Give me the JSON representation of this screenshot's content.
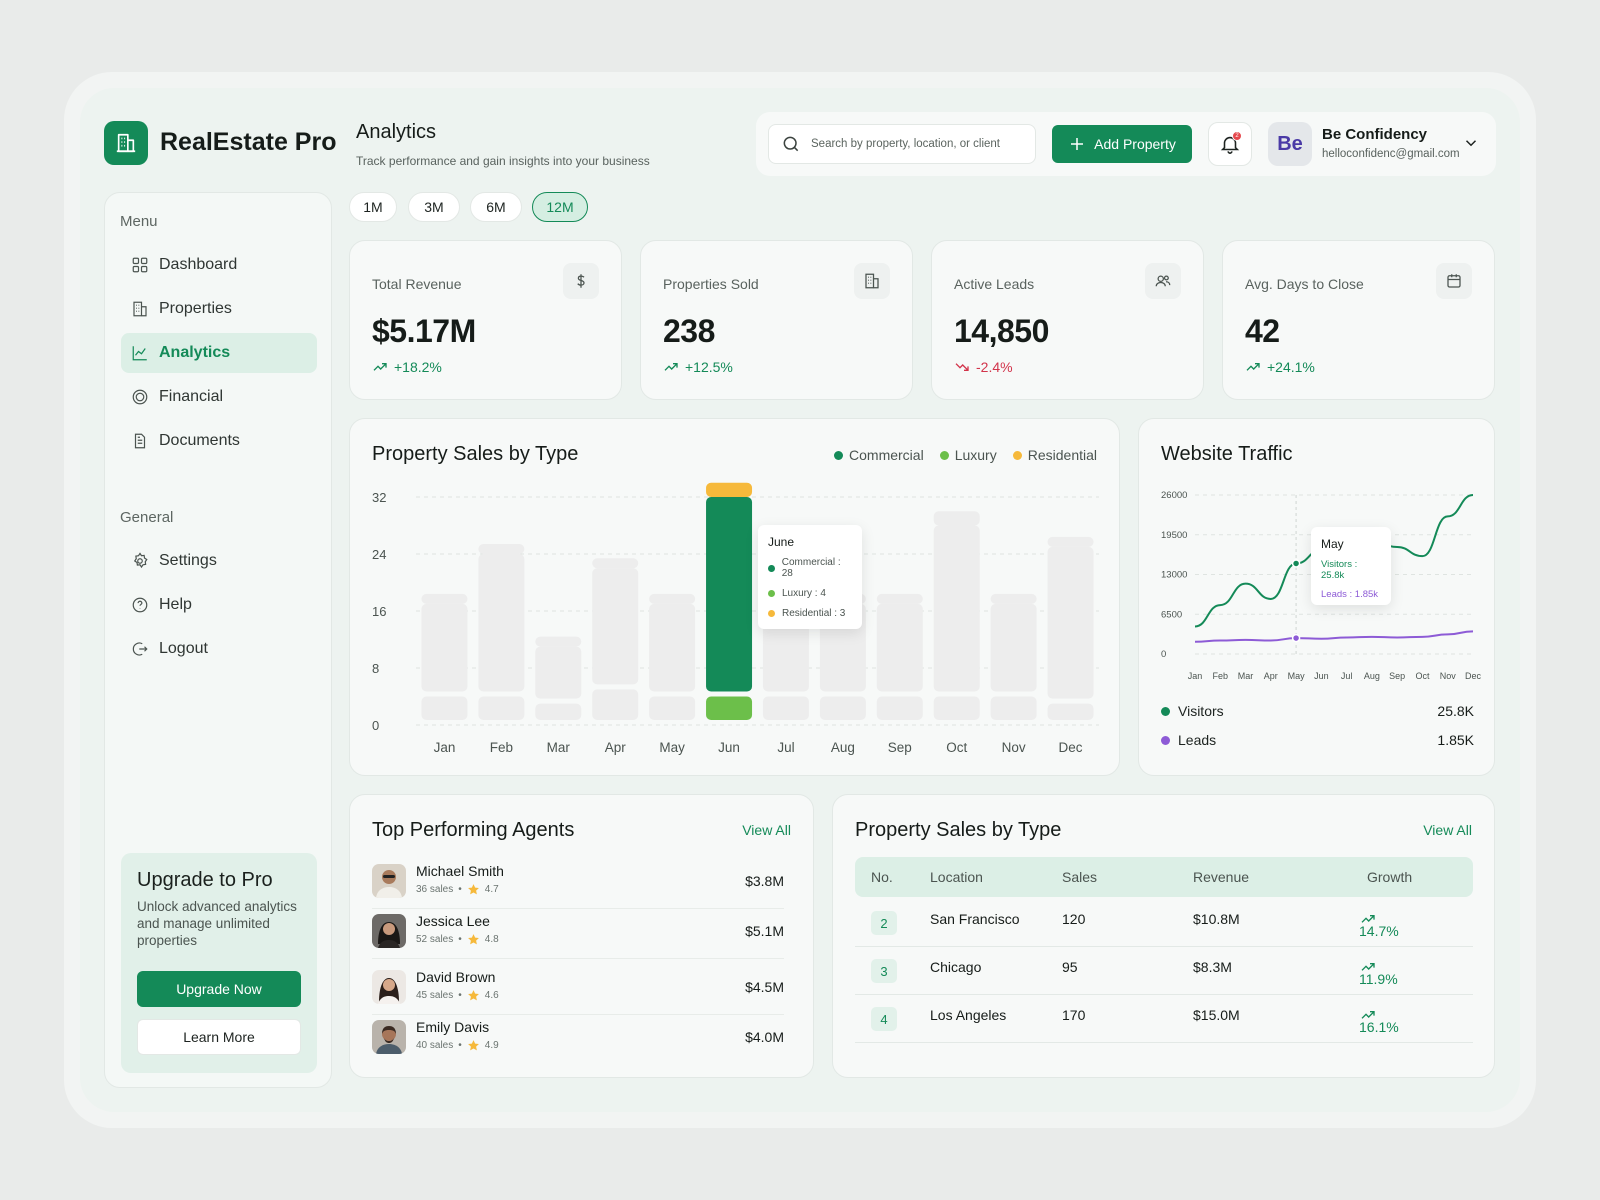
{
  "app": {
    "name": "RealEstate Pro"
  },
  "header": {
    "title": "Analytics",
    "subtitle": "Track performance and gain insights into your business"
  },
  "search": {
    "placeholder": "Search by property, location, or client"
  },
  "actions": {
    "add_property": "Add Property",
    "notification_count": "2"
  },
  "user": {
    "initials": "Be",
    "name": "Be Confidency",
    "email": "helloconfidenc@gmail.com"
  },
  "sidebar": {
    "menu_heading": "Menu",
    "menu_items": [
      {
        "label": "Dashboard",
        "icon": "grid-icon"
      },
      {
        "label": "Properties",
        "icon": "building-icon"
      },
      {
        "label": "Analytics",
        "icon": "chart-icon",
        "active": true
      },
      {
        "label": "Financial",
        "icon": "coin-icon"
      },
      {
        "label": "Documents",
        "icon": "document-icon"
      }
    ],
    "general_heading": "General",
    "general_items": [
      {
        "label": "Settings",
        "icon": "gear-icon"
      },
      {
        "label": "Help",
        "icon": "help-icon"
      },
      {
        "label": "Logout",
        "icon": "logout-icon"
      }
    ],
    "upgrade": {
      "title": "Upgrade to Pro",
      "text": "Unlock advanced analytics and manage unlimited properties",
      "primary": "Upgrade Now",
      "secondary": "Learn More"
    }
  },
  "periods": {
    "options": [
      "1M",
      "3M",
      "6M",
      "12M"
    ],
    "selected": "12M"
  },
  "stats": [
    {
      "label": "Total Revenue",
      "value": "$5.17M",
      "delta": "+18.2%",
      "trend": "up",
      "icon": "dollar-icon"
    },
    {
      "label": "Properties Sold",
      "value": "238",
      "delta": "+12.5%",
      "trend": "up",
      "icon": "building-icon"
    },
    {
      "label": "Active Leads",
      "value": "14,850",
      "delta": "-2.4%",
      "trend": "down",
      "icon": "users-icon"
    },
    {
      "label": "Avg. Days to Close",
      "value": "42",
      "delta": "+24.1%",
      "trend": "up",
      "icon": "calendar-icon"
    }
  ],
  "colors": {
    "commercial": "#148a58",
    "luxury": "#6cbf4a",
    "residential": "#f6b93b",
    "visitors": "#148a58",
    "leads": "#8d5bd6",
    "accent": "#148a58"
  },
  "sales_chart": {
    "title": "Property Sales by Type",
    "legend": [
      "Commercial",
      "Luxury",
      "Residential"
    ],
    "tooltip": {
      "month": "June",
      "rows": [
        "Commercial : 28",
        "Luxury : 4",
        "Residential : 3"
      ]
    }
  },
  "traffic_chart": {
    "title": "Website Traffic",
    "tooltip": {
      "month": "May",
      "visitors": "Visitors : 25.8k",
      "leads": "Leads : 1.85k"
    },
    "totals": [
      {
        "label": "Visitors",
        "value": "25.8K"
      },
      {
        "label": "Leads",
        "value": "1.85K"
      }
    ]
  },
  "chart_data": [
    {
      "type": "bar",
      "title": "Property Sales by Type",
      "categories": [
        "Jan",
        "Feb",
        "Mar",
        "Apr",
        "May",
        "Jun",
        "Jul",
        "Aug",
        "Sep",
        "Oct",
        "Nov",
        "Dec"
      ],
      "yticks": [
        0,
        8,
        16,
        24,
        32
      ],
      "ylim": [
        0,
        32
      ],
      "highlight": "Jun",
      "series": [
        {
          "name": "Commercial",
          "values": [
            13,
            20,
            8,
            17,
            13,
            28,
            13,
            13,
            13,
            24,
            13,
            22
          ]
        },
        {
          "name": "Luxury",
          "values": [
            4,
            4,
            3,
            5,
            4,
            4,
            4,
            4,
            4,
            4,
            4,
            3
          ]
        },
        {
          "name": "Residential",
          "values": [
            1,
            1,
            1,
            1,
            1,
            2,
            1,
            1,
            1,
            2,
            1,
            1
          ]
        }
      ],
      "legend_position": "top-right",
      "grid": true
    },
    {
      "type": "line",
      "title": "Website Traffic",
      "categories": [
        "Jan",
        "Feb",
        "Mar",
        "Apr",
        "May",
        "Jun",
        "Jul",
        "Aug",
        "Sep",
        "Oct",
        "Nov",
        "Dec"
      ],
      "yticks": [
        0,
        6500,
        13000,
        19500,
        26000
      ],
      "ylim": [
        0,
        26000
      ],
      "highlight": "May",
      "series": [
        {
          "name": "Visitors",
          "values": [
            4500,
            8000,
            11500,
            9000,
            14800,
            17000,
            20000,
            18500,
            17500,
            16000,
            22500,
            26000
          ]
        },
        {
          "name": "Leads",
          "values": [
            2000,
            2200,
            2300,
            2200,
            2600,
            2500,
            2700,
            2800,
            2700,
            2800,
            3200,
            3700
          ]
        }
      ],
      "grid": true
    }
  ],
  "agents": {
    "title": "Top Performing Agents",
    "view_all": "View All",
    "rows": [
      {
        "name": "Michael Smith",
        "sales": "36 sales",
        "rating": "4.7",
        "revenue": "$3.8M"
      },
      {
        "name": "Jessica Lee",
        "sales": "52 sales",
        "rating": "4.8",
        "revenue": "$5.1M"
      },
      {
        "name": "David Brown",
        "sales": "45 sales",
        "rating": "4.6",
        "revenue": "$4.5M"
      },
      {
        "name": "Emily Davis",
        "sales": "40 sales",
        "rating": "4.9",
        "revenue": "$4.0M"
      }
    ]
  },
  "locations": {
    "title": "Property Sales by Type",
    "view_all": "View All",
    "columns": [
      "No.",
      "Location",
      "Sales",
      "Revenue",
      "Growth"
    ],
    "rows": [
      {
        "no": "2",
        "location": "San Francisco",
        "sales": "120",
        "revenue": "$10.8M",
        "growth": "14.7%"
      },
      {
        "no": "3",
        "location": "Chicago",
        "sales": "95",
        "revenue": "$8.3M",
        "growth": "11.9%"
      },
      {
        "no": "4",
        "location": "Los Angeles",
        "sales": "170",
        "revenue": "$15.0M",
        "growth": "16.1%"
      }
    ]
  }
}
